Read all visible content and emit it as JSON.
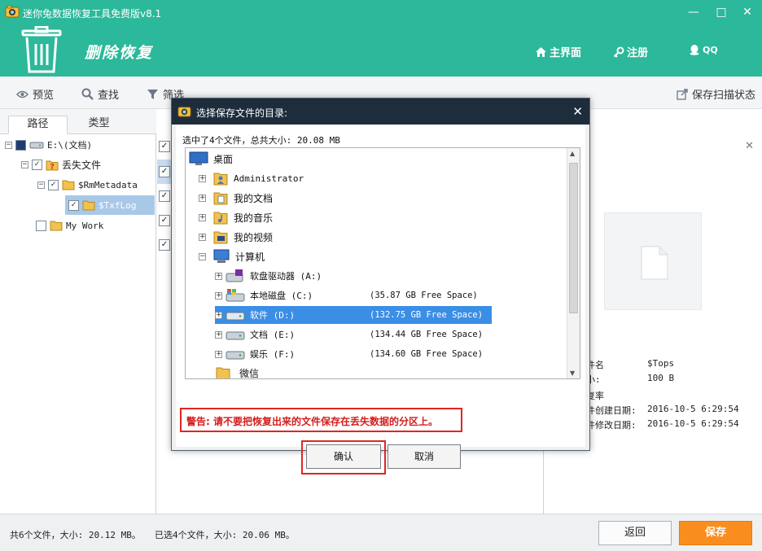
{
  "window": {
    "title": "迷你兔数据恢复工具免费版v8.1",
    "mode_title": "删除恢复",
    "controls": {
      "minimize": "—",
      "maximize": "□",
      "close": "✕"
    },
    "colors": {
      "accent": "#2cb89a",
      "save": "#f98e1f",
      "warning": "#e02525",
      "selection": "#3a8ee6"
    }
  },
  "header_nav": [
    {
      "label": "主界面",
      "icon": "home-icon"
    },
    {
      "label": "注册",
      "icon": "key-icon"
    },
    {
      "label": "QQ",
      "icon": "qq-icon"
    }
  ],
  "toolbar": {
    "preview": "预览",
    "search": "查找",
    "filter": "筛选",
    "save_scan_state": "保存扫描状态"
  },
  "left_panel": {
    "tabs": [
      "路径",
      "类型"
    ],
    "tree": [
      {
        "label": "E:\\(文档)"
      },
      {
        "label": "丢失文件"
      },
      {
        "label": "$RmMetadata"
      },
      {
        "label": "$TxfLog"
      },
      {
        "label": "My Work"
      }
    ]
  },
  "right_panel": {
    "close": "✕",
    "info": [
      {
        "key": "件名",
        "value": "$Tops"
      },
      {
        "key": "小:",
        "value": "100 B"
      },
      {
        "key": "件创建日期:",
        "value": "2016-10-5 6:29:54"
      },
      {
        "key": "件修改日期:",
        "value": "2016-10-5 6:29:54"
      },
      {
        "key": "复率",
        "value": ""
      }
    ]
  },
  "status": {
    "total": "共6个文件，大小: 20.12 MB。",
    "selected": "已选4个文件，大小: 20.06 MB。",
    "back": "返回",
    "save": "保存"
  },
  "dialog": {
    "title": "选择保存文件的目录:",
    "close": "✕",
    "selection_info": "选中了4个文件，总共大小: 20.08 MB",
    "tree": [
      {
        "label": "桌面",
        "free": ""
      },
      {
        "label": "Administrator",
        "free": ""
      },
      {
        "label": "我的文档",
        "free": ""
      },
      {
        "label": "我的音乐",
        "free": ""
      },
      {
        "label": "我的视频",
        "free": ""
      },
      {
        "label": "计算机",
        "free": ""
      },
      {
        "label": "软盘驱动器 (A:)",
        "free": ""
      },
      {
        "label": "本地磁盘 (C:)",
        "free": "(35.87 GB Free Space)"
      },
      {
        "label": "软件 (D:)",
        "free": "(132.75 GB Free Space)"
      },
      {
        "label": "文档 (E:)",
        "free": "(134.44 GB Free Space)"
      },
      {
        "label": "娱乐 (F:)",
        "free": "(134.60 GB Free Space)"
      },
      {
        "label": "微信",
        "free": ""
      }
    ],
    "warning": "警告: 请不要把恢复出来的文件保存在丢失数据的分区上。",
    "ok": "确认",
    "cancel": "取消"
  }
}
